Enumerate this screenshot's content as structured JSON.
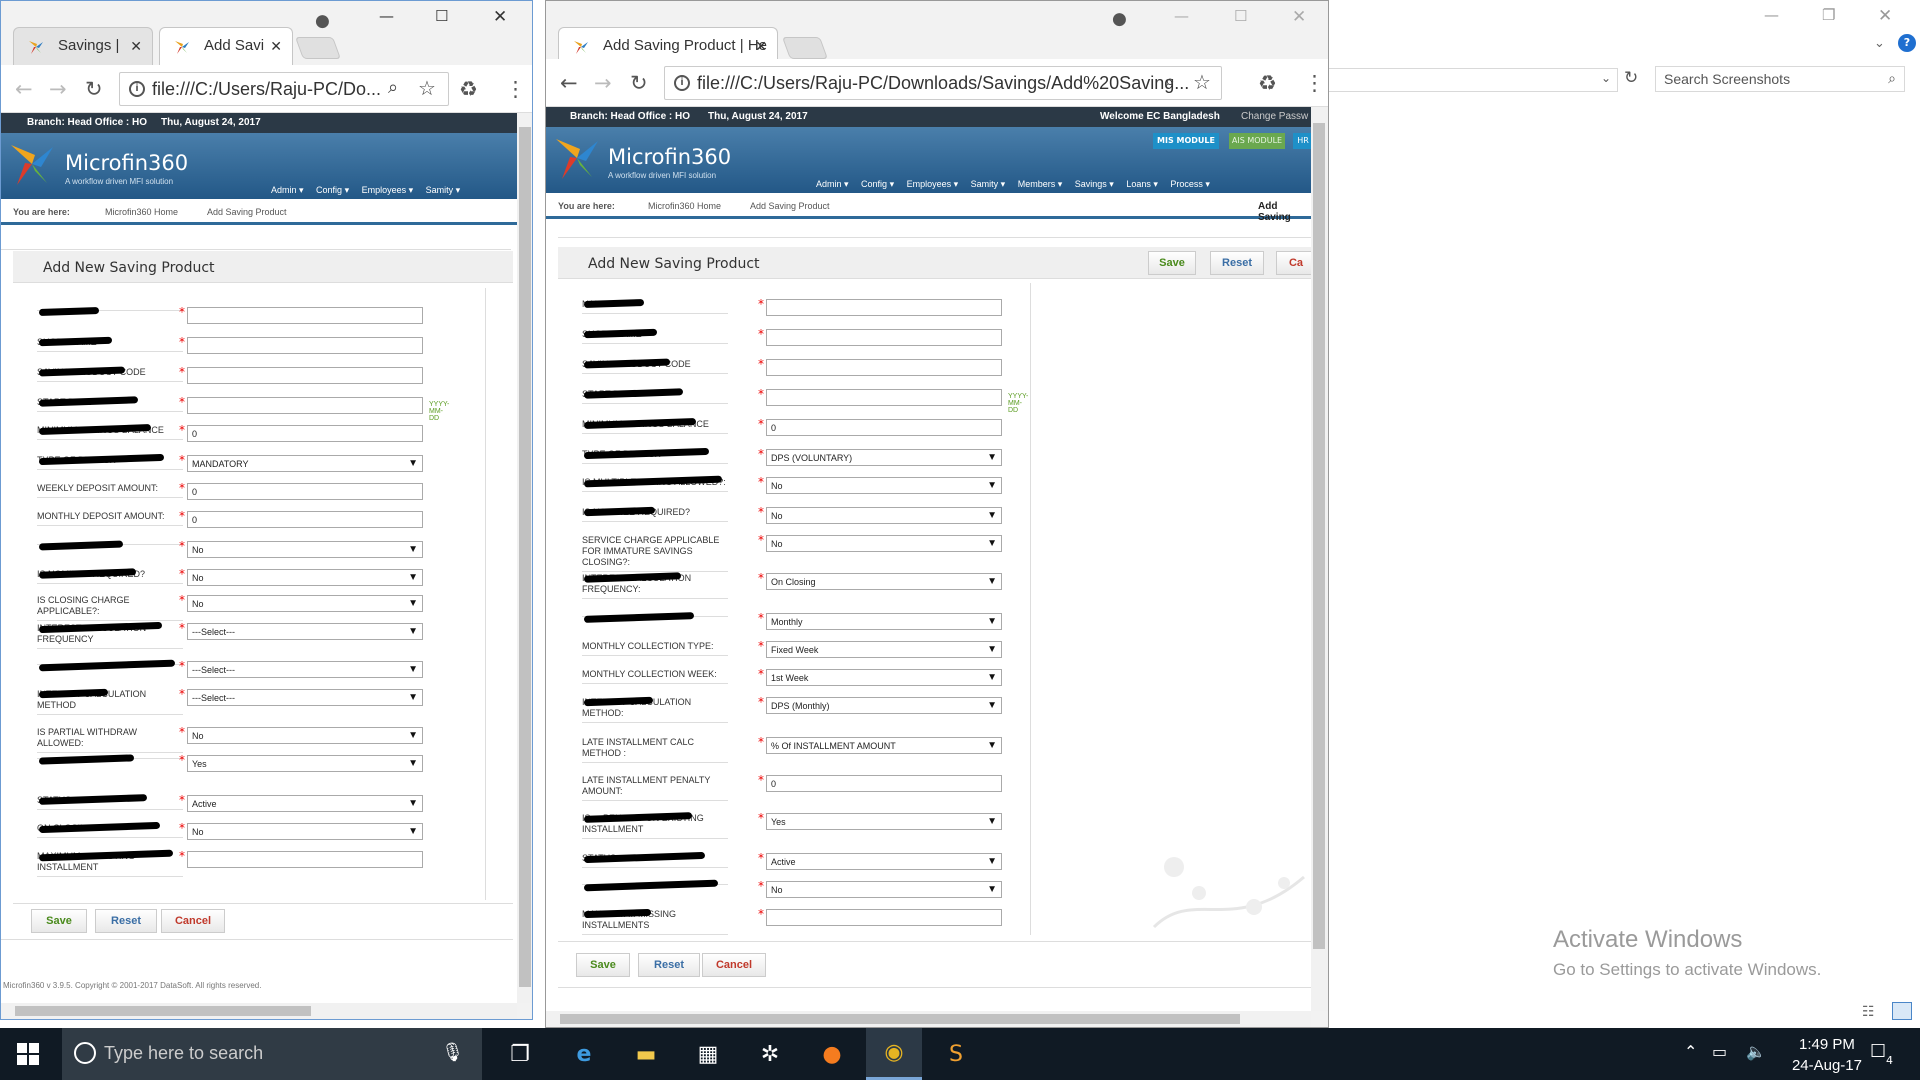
{
  "explorer": {
    "search_placeholder": "Search Screenshots",
    "activate_title": "Activate Windows",
    "activate_sub": "Go to Settings to activate Windows.",
    "help_badge": "?"
  },
  "left_window": {
    "tabs": [
      {
        "label": "Savings |"
      },
      {
        "label": "Add Savi"
      }
    ],
    "url": "file:///C:/Users/Raju-PC/Do...",
    "info_left": "Branch: Head Office : HO",
    "info_date": "Thu, August 24, 2017",
    "brand": "Microfin360",
    "tagline": "A workflow driven MFI solution",
    "menu": [
      "Admin ▾",
      "Config ▾",
      "Employees ▾",
      "Samity ▾"
    ],
    "crumb_label": "You are here:",
    "crumbs": [
      "Microfin360 Home",
      "Add Saving Product"
    ],
    "panel_title": "Add New Saving Product",
    "rows": [
      {
        "label": "",
        "value": "",
        "select": false
      },
      {
        "label": "SHORT NAME",
        "value": "",
        "select": false
      },
      {
        "label": "SAVING PRODUCT CODE",
        "value": "",
        "select": false
      },
      {
        "label": "START DATE",
        "value": "",
        "select": false
      },
      {
        "label": "MINIMUM SAVINGS BALANCE",
        "value": "0",
        "select": false
      },
      {
        "label": "TYPE OF DEPOSIT",
        "value": "MANDATORY",
        "select": true
      },
      {
        "label": "WEEKLY DEPOSIT AMOUNT:",
        "value": "0",
        "select": false
      },
      {
        "label": "MONTHLY DEPOSIT AMOUNT:",
        "value": "0",
        "select": false
      },
      {
        "label": "",
        "value": "No",
        "select": true
      },
      {
        "label": "IS NOMINEE REQUIRED?",
        "value": "No",
        "select": true
      },
      {
        "label": "IS CLOSING CHARGE APPLICABLE?:",
        "value": "No",
        "select": true
      },
      {
        "label": "INTEREST CALCULATION FREQUENCY",
        "value": "---Select---",
        "select": true
      },
      {
        "label": "",
        "value": "---Select---",
        "select": true
      },
      {
        "label": "INTEREST CALCULATION METHOD",
        "value": "---Select---",
        "select": true
      },
      {
        "label": "IS PARTIAL WITHDRAW ALLOWED:",
        "value": "No",
        "select": true
      },
      {
        "label": "",
        "value": "Yes",
        "select": true
      },
      {
        "label": "STATUS",
        "value": "Active",
        "select": true
      },
      {
        "label": "ON CLOSING",
        "value": "No",
        "select": true
      },
      {
        "label": "MAXIMUM ... EXISTING INSTALLMENT",
        "value": "",
        "select": false
      }
    ],
    "date_hint": "YYYY-MM-DD",
    "buttons": {
      "save": "Save",
      "reset": "Reset",
      "cancel": "Cancel"
    },
    "footer": "Microfin360 v 3.9.5. Copyright © 2001-2017 DataSoft. All rights reserved."
  },
  "right_window": {
    "tabs": [
      {
        "label": "Add Saving Product | He"
      }
    ],
    "url": "file:///C:/Users/Raju-PC/Downloads/Savings/Add%20Saving...",
    "info_left": "Branch: Head Office : HO",
    "info_date": "Thu, August 24, 2017",
    "info_welcome": "Welcome EC Bangladesh",
    "info_change": "Change Passw",
    "brand": "Microfin360",
    "tagline": "A workflow driven MFI solution",
    "modules": [
      "MIS MODULE",
      "AIS MODULE",
      "HR"
    ],
    "menu": [
      "Admin ▾",
      "Config ▾",
      "Employees ▾",
      "Samity ▾",
      "Members ▾",
      "Savings ▾",
      "Loans ▾",
      "Process ▾"
    ],
    "crumb_label": "You are here:",
    "crumbs": [
      "Microfin360 Home",
      "Add Saving Product"
    ],
    "crumb_right": "Add Saving",
    "panel_title": "Add New Saving Product",
    "top_buttons": {
      "save": "Save",
      "reset": "Reset",
      "cancel": "Ca"
    },
    "rows": [
      {
        "label": "NAME",
        "value": "",
        "select": false
      },
      {
        "label": "SHORT NAME",
        "value": "",
        "select": false
      },
      {
        "label": "SAVING PRODUCT CODE",
        "value": "",
        "select": false
      },
      {
        "label": "START DATE",
        "value": "",
        "select": false
      },
      {
        "label": "MINIMUM SAVINGS BALANCE",
        "value": "0",
        "select": false
      },
      {
        "label": "TYPE OF DEPOSIT",
        "value": "DPS (VOLUNTARY)",
        "select": true
      },
      {
        "label": "IS MULTIPLE SAVING ALLOWED?:",
        "value": "No",
        "select": true
      },
      {
        "label": "IS NOMINEE REQUIRED?",
        "value": "No",
        "select": true
      },
      {
        "label": "SERVICE CHARGE APPLICABLE FOR IMMATURE SAVINGS CLOSING?:",
        "value": "No",
        "select": true
      },
      {
        "label": "INTEREST CALCULATION FREQUENCY:",
        "value": "On Closing",
        "select": true
      },
      {
        "label": "",
        "value": "Monthly",
        "select": true
      },
      {
        "label": "MONTHLY COLLECTION TYPE:",
        "value": "Fixed Week",
        "select": true
      },
      {
        "label": "MONTHLY COLLECTION WEEK:",
        "value": "1st Week",
        "select": true
      },
      {
        "label": "INTEREST CALCULATION METHOD:",
        "value": "DPS (Monthly)",
        "select": true
      },
      {
        "label": "LATE INSTALLMENT CALC METHOD :",
        "value": "% Of INSTALLMENT AMOUNT",
        "select": true
      },
      {
        "label": "LATE INSTALLMENT PENALTY AMOUNT:",
        "value": "0",
        "select": false
      },
      {
        "label": "IS ... PENALTY ON EXISTING INSTALLMENT",
        "value": "Yes",
        "select": true
      },
      {
        "label": "STATUS",
        "value": "Active",
        "select": true
      },
      {
        "label": "",
        "value": "No",
        "select": true
      },
      {
        "label": "MAXIMUM ... MISSING INSTALLMENTS",
        "value": "",
        "select": false
      }
    ],
    "date_hint": "YYYY-MM-DD",
    "buttons": {
      "save": "Save",
      "reset": "Reset",
      "cancel": "Cancel"
    }
  },
  "taskbar": {
    "search_placeholder": "Type here to search",
    "time": "1:49 PM",
    "date": "24-Aug-17",
    "notif_count": "4"
  },
  "colors": {
    "banner": "#235887",
    "infobar": "#2b3946",
    "save": "#4a8a1c",
    "reset": "#3a6ea5",
    "cancel": "#c0392b"
  }
}
